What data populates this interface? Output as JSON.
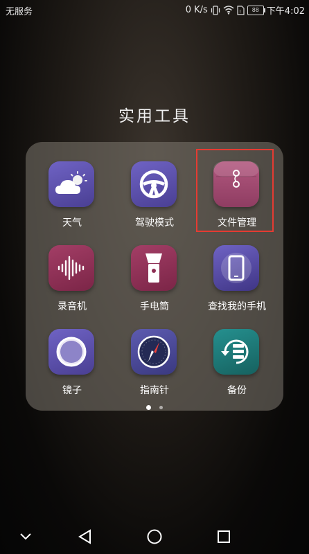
{
  "status_bar": {
    "carrier": "无服务",
    "net_speed": "0 K/s",
    "battery": "88",
    "time": "下午4:02",
    "icons": [
      "vibrate-icon",
      "wifi-icon",
      "sim-icon",
      "battery-icon"
    ]
  },
  "folder": {
    "title": "实用工具",
    "apps": [
      {
        "label": "天气",
        "icon": "weather-icon",
        "color": "#5b4fa8"
      },
      {
        "label": "驾驶模式",
        "icon": "steering-wheel-icon",
        "color": "#5b4fa8"
      },
      {
        "label": "文件管理",
        "icon": "file-folder-icon",
        "color": "#a04c72"
      },
      {
        "label": "录音机",
        "icon": "sound-wave-icon",
        "color": "#8e2f54"
      },
      {
        "label": "手电筒",
        "icon": "flashlight-icon",
        "color": "#8e2f54"
      },
      {
        "label": "查找我的手机",
        "icon": "find-phone-icon",
        "color": "#5b4fa8"
      },
      {
        "label": "镜子",
        "icon": "mirror-icon",
        "color": "#5b4fa8"
      },
      {
        "label": "指南针",
        "icon": "compass-icon",
        "color": "#4a4a9a"
      },
      {
        "label": "备份",
        "icon": "backup-icon",
        "color": "#1e7a7a"
      }
    ],
    "page_count": 2,
    "current_page": 1,
    "highlighted_app": "文件管理"
  },
  "nav_bar": {
    "buttons": [
      "collapse-icon",
      "back-icon",
      "home-icon",
      "recents-icon"
    ]
  }
}
